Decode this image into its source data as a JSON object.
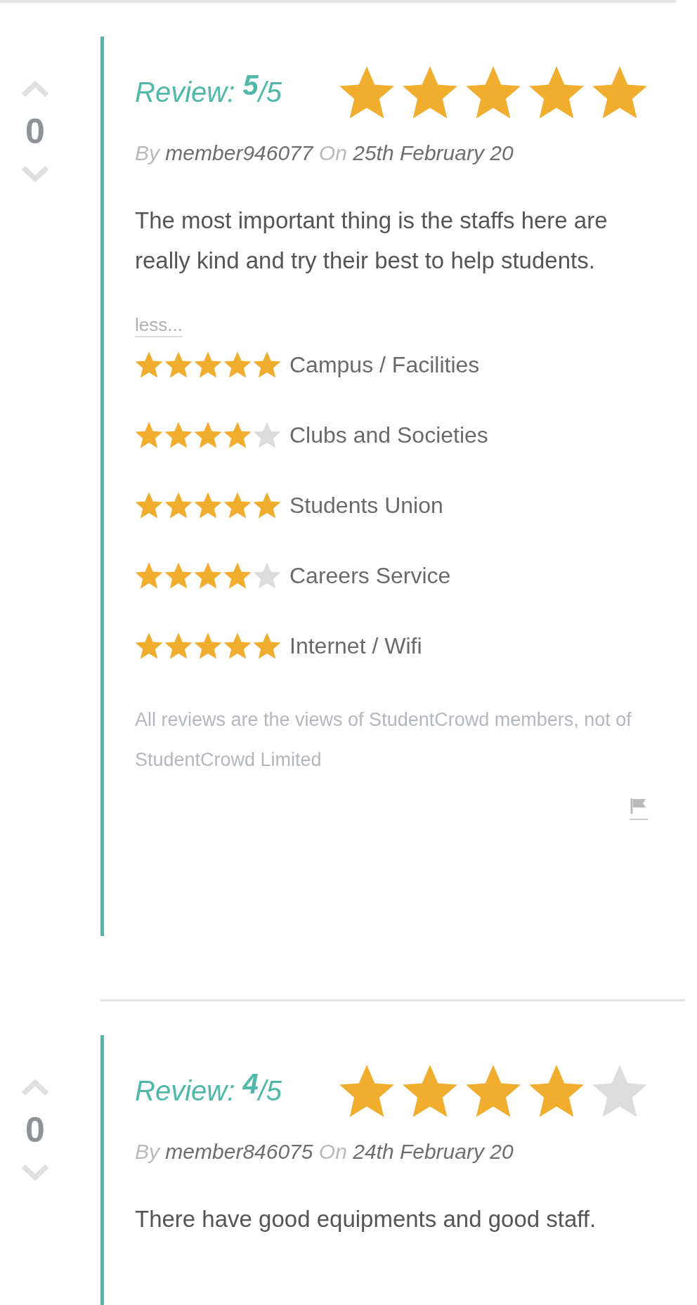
{
  "reviews": [
    {
      "votes": "0",
      "title_label": "Review:",
      "score": "5",
      "out_of": "/5",
      "stars": 5,
      "by_label": "By",
      "author": "member946077",
      "on_label": "On",
      "date": "25th February 20",
      "body": "The most important thing is the staffs here are really kind and try their best to help students.",
      "less_link": "less...",
      "categories": [
        {
          "name": "Campus / Facilities",
          "stars": 5
        },
        {
          "name": "Clubs and Societies",
          "stars": 4
        },
        {
          "name": "Students Union",
          "stars": 5
        },
        {
          "name": "Careers Service",
          "stars": 4
        },
        {
          "name": "Internet / Wifi",
          "stars": 5
        }
      ],
      "disclaimer": "All reviews are the views of StudentCrowd members, not of StudentCrowd Limited"
    },
    {
      "votes": "0",
      "title_label": "Review:",
      "score": "4",
      "out_of": "/5",
      "stars": 4,
      "by_label": "By",
      "author": "member846075",
      "on_label": "On",
      "date": "24th February 20",
      "body": "There have good equipments and good staff."
    }
  ]
}
